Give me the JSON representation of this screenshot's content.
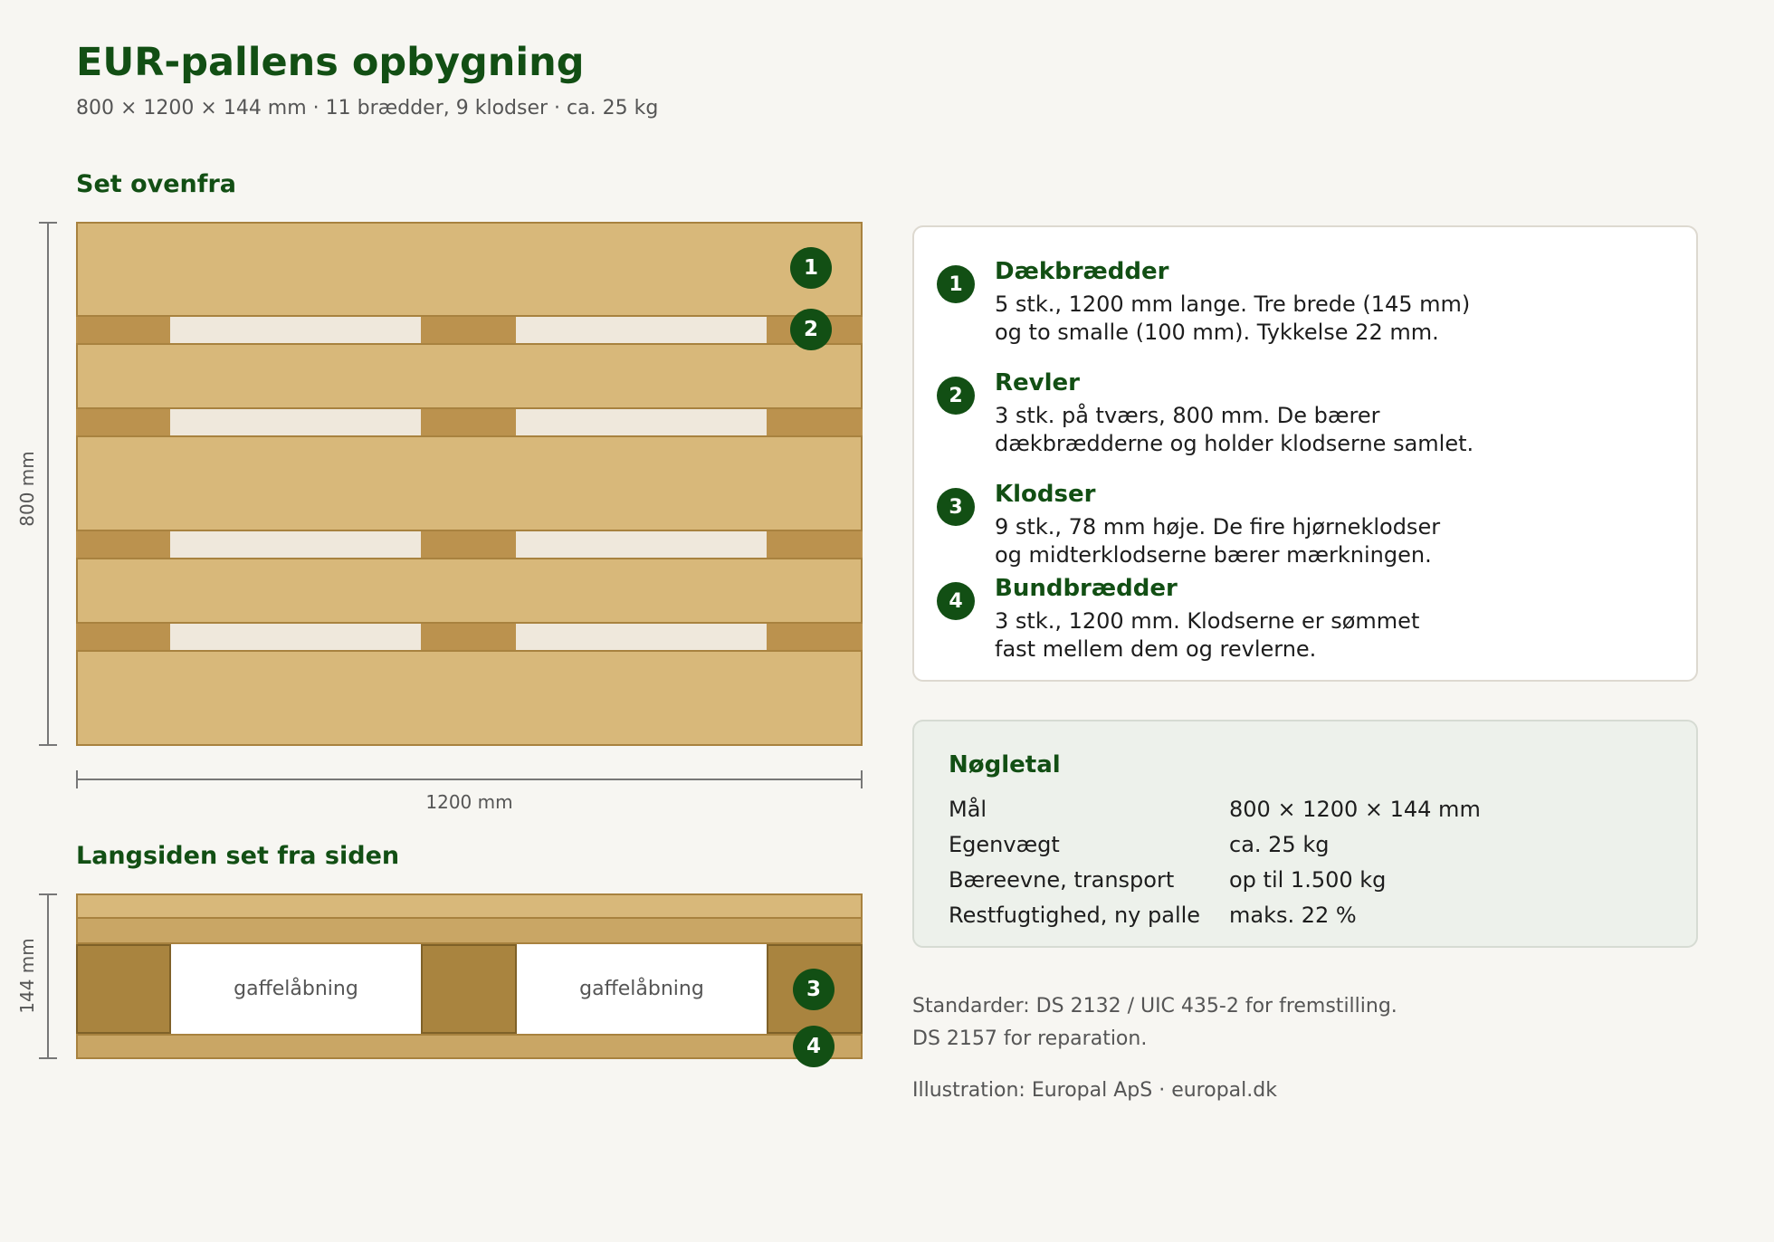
{
  "header": {
    "title": "EUR-pallens opbygning",
    "subtitle": "800 × 1200 × 144 mm · 11 brædder, 9 klodser · ca. 25 kg"
  },
  "top_view": {
    "heading": "Set ovenfra",
    "width_label": "1200 mm",
    "height_label": "800 mm"
  },
  "side_view": {
    "heading": "Langsiden set fra siden",
    "height_label": "144 mm",
    "fork_label_1": "gaffelåbning",
    "fork_label_2": "gaffelåbning"
  },
  "badges": [
    "1",
    "2",
    "3",
    "4"
  ],
  "legend": [
    {
      "num": "1",
      "title": "Dækbrædder",
      "line1": "5 stk., 1200 mm lange. Tre brede (145 mm)",
      "line2": "og to smalle (100 mm). Tykkelse 22 mm."
    },
    {
      "num": "2",
      "title": "Revler",
      "line1": "3 stk. på tværs, 800 mm. De bærer",
      "line2": "dækbrædderne og holder klodserne samlet."
    },
    {
      "num": "3",
      "title": "Klodser",
      "line1": "9 stk., 78 mm høje. De fire hjørneklodser",
      "line2": "og midterklodserne bærer mærkningen."
    },
    {
      "num": "4",
      "title": "Bundbrædder",
      "line1": "3 stk., 1200 mm. Klodserne er sømmet",
      "line2": "fast mellem dem og revlerne."
    }
  ],
  "facts": {
    "title": "Nøgletal",
    "rows": [
      {
        "label": "Mål",
        "value": "800 × 1200 × 144 mm"
      },
      {
        "label": "Egenvægt",
        "value": "ca. 25 kg"
      },
      {
        "label": "Bæreevne, transport",
        "value": "op til 1.500 kg"
      },
      {
        "label": "Restfugtighed, ny palle",
        "value": "maks. 22 %"
      }
    ]
  },
  "notes": {
    "standards_line1": "Standarder: DS 2132 / UIC 435-2 for fremstilling.",
    "standards_line2": "DS 2157 for reparation.",
    "credit": "Illustration: Europal ApS · europal.dk"
  },
  "colors": {
    "accent": "#124f14",
    "deck_board": "#d8b87a",
    "stringer": "#bb924e",
    "block": "#a9843f",
    "background": "#f7f6f2"
  }
}
